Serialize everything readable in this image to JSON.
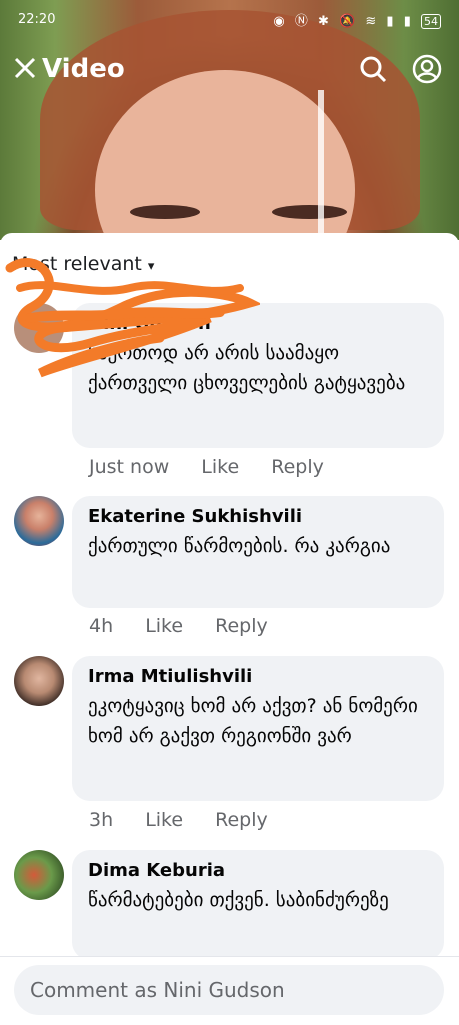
{
  "status_bar": {
    "time": "22:20",
    "icons": [
      "eye-icon",
      "nfc-icon",
      "bluetooth-icon",
      "mute-icon",
      "wifi-icon",
      "signal-icon",
      "signal-icon"
    ],
    "battery": "54"
  },
  "header": {
    "title": "Video",
    "close_icon": "close-icon",
    "search_icon": "search-icon",
    "profile_icon": "profile-icon"
  },
  "sort": {
    "label": "Most relevant"
  },
  "comments": [
    {
      "author": "Nini Gudson",
      "text": "საერთოდ არ არის საამაყო ქართველი ცხოველების გატყავება",
      "time": "Just now",
      "like": "Like",
      "reply": "Reply"
    },
    {
      "author": "Ekaterine Sukhishvili",
      "text": "ქართული წარმოების. რა კარგია",
      "time": "4h",
      "like": "Like",
      "reply": "Reply"
    },
    {
      "author": "Irma  Mtiulishvili",
      "text": "ეკოტყავიც ხომ არ აქვთ? ან ნომერი ხომ არ გაქვთ რეგიონში ვარ",
      "time": "3h",
      "like": "Like",
      "reply": "Reply"
    },
    {
      "author": "Dima Keburia",
      "text": "წარმატებები თქვენ. საბინძურეზე",
      "time": "",
      "like": "",
      "reply": ""
    }
  ],
  "composer": {
    "placeholder": "Comment as Nini Gudson"
  },
  "colors": {
    "accent": "#f37b29",
    "bubble": "#f0f2f5",
    "meta": "#65676b"
  }
}
